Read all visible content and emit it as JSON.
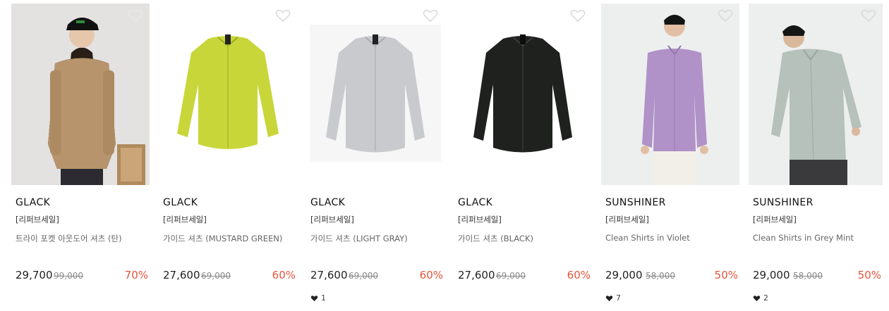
{
  "colors": {
    "discount": "#e2553b",
    "text": "#222222",
    "muted": "#888888"
  },
  "products": [
    {
      "brand": "GLACK",
      "badge": "[리퍼브세일]",
      "name": "트라이 포켓 아웃도어 셔츠 (탄)",
      "price": "29,700",
      "original_price": "99,000",
      "discount": "70%",
      "likes": null,
      "shirt_color": "#b8946c",
      "image": "model-tan-shirt"
    },
    {
      "brand": "GLACK",
      "badge": "[리퍼브세일]",
      "name": "가이드 셔츠 (MUSTARD GREEN)",
      "price": "27,600",
      "original_price": "69,000",
      "discount": "60%",
      "likes": null,
      "shirt_color": "#c8d63a",
      "image": "flat-mustard-shirt"
    },
    {
      "brand": "GLACK",
      "badge": "[리퍼브세일]",
      "name": "가이드 셔츠 (LIGHT GRAY)",
      "price": "27,600",
      "original_price": "69,000",
      "discount": "60%",
      "likes": "1",
      "shirt_color": "#c9cacd",
      "image": "flat-gray-shirt"
    },
    {
      "brand": "GLACK",
      "badge": "[리퍼브세일]",
      "name": "가이드 셔츠 (BLACK)",
      "price": "27,600",
      "original_price": "69,000",
      "discount": "60%",
      "likes": null,
      "shirt_color": "#1e211e",
      "image": "flat-black-shirt"
    },
    {
      "brand": "SUNSHINER",
      "badge": "[리퍼브세일]",
      "name": "Clean Shirts in Violet",
      "price": "29,000",
      "original_price": "58,000",
      "discount": "50%",
      "likes": "7",
      "shirt_color": "#b092c8",
      "image": "model-violet-shirt"
    },
    {
      "brand": "SUNSHINER",
      "badge": "[리퍼브세일]",
      "name": "Clean Shirts in Grey Mint",
      "price": "29,000",
      "original_price": "58,000",
      "discount": "50%",
      "likes": "2",
      "shirt_color": "#b6c1bb",
      "image": "model-greymint-shirt"
    }
  ]
}
